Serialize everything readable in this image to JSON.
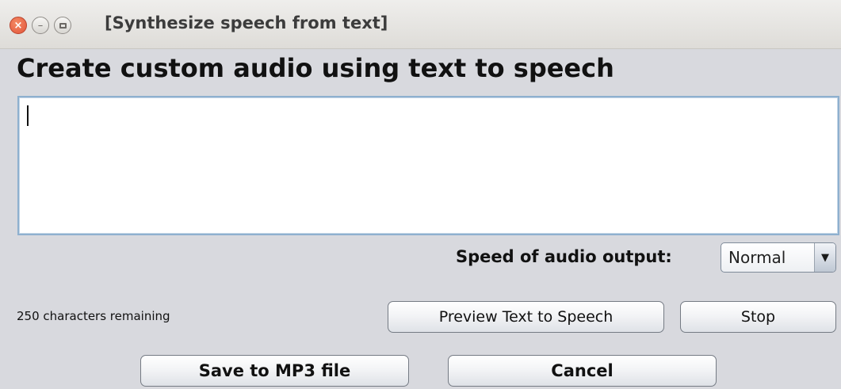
{
  "window": {
    "title": "[Synthesize speech from text]",
    "close_glyph": "×",
    "minimize_glyph": "–"
  },
  "heading": "Create custom audio using text to speech",
  "text_input": {
    "value": "",
    "placeholder": ""
  },
  "speed": {
    "label": "Speed of audio output:",
    "selected": "Normal",
    "arrow_glyph": "▼"
  },
  "status": {
    "chars_remaining": "250 characters remaining"
  },
  "buttons": {
    "preview": "Preview Text to Speech",
    "stop": "Stop",
    "save": "Save to MP3 file",
    "cancel": "Cancel"
  },
  "colors": {
    "window_bg": "#d8d9de",
    "close_button": "#e2543a",
    "textarea_border": "#8eb0cf"
  },
  "icons": [
    "close-icon",
    "minimize-icon",
    "maximize-icon",
    "dropdown-arrow-icon"
  ]
}
